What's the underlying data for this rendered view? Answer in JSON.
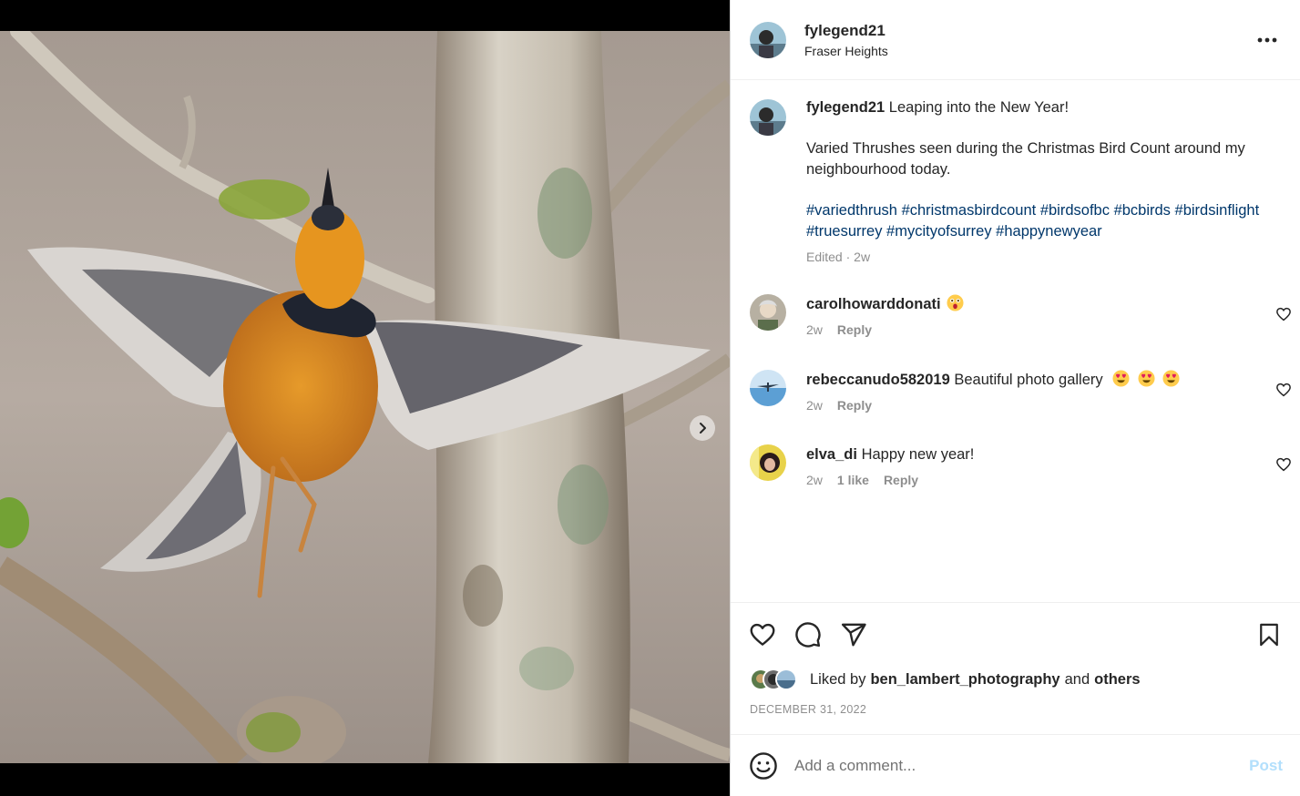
{
  "post": {
    "username": "fylegend21",
    "location": "Fraser Heights",
    "more_icon": "more-horizontal-icon"
  },
  "caption": {
    "username": "fylegend21",
    "title": "Leaping into the New Year!",
    "body": "Varied Thrushes seen during the Christmas Bird Count around my neighbourhood today.",
    "hashtags": [
      "#variedthrush",
      "#christmasbirdcount",
      "#birdsofbc",
      "#bcbirds",
      "#birdsinflight",
      "#truesurrey",
      "#mycityofsurrey",
      "#happynewyear"
    ],
    "edited": "Edited",
    "time": "2w"
  },
  "comments": [
    {
      "username": "carolhowarddonati",
      "text": "",
      "emoji": [
        "astonished-face-emoji"
      ],
      "time": "2w",
      "likes": "",
      "reply": "Reply"
    },
    {
      "username": "rebeccanudo582019",
      "text": "Beautiful photo gallery",
      "emoji": [
        "heart-eyes-emoji",
        "heart-eyes-emoji",
        "heart-eyes-emoji"
      ],
      "time": "2w",
      "likes": "",
      "reply": "Reply"
    },
    {
      "username": "elva_di",
      "text": "Happy new year!",
      "emoji": [],
      "time": "2w",
      "likes": "1 like",
      "reply": "Reply"
    }
  ],
  "likes": {
    "prefix": "Liked by",
    "user": "ben_lambert_photography",
    "and": "and",
    "others": "others"
  },
  "date": "DECEMBER 31, 2022",
  "add_comment": {
    "placeholder": "Add a comment...",
    "post_label": "Post"
  },
  "carousel": {
    "current": 1,
    "total": 2
  },
  "colors": {
    "link": "#00376b",
    "post_disabled": "#b2dffc",
    "muted": "#8e8e8e",
    "carousel_active": "#0095f6"
  }
}
